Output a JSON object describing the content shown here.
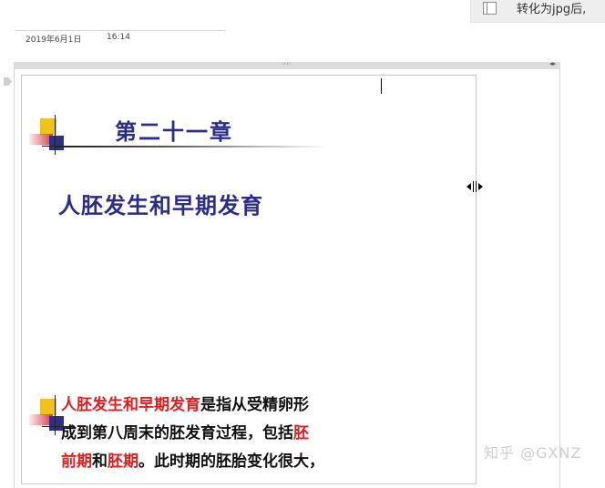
{
  "tooltip": {
    "icon": "document-icon",
    "text": "转化为jpg后,"
  },
  "note": {
    "date": "2019年6月1日",
    "time": "16:14"
  },
  "container": {
    "grip": "····",
    "arrows": "◂▸"
  },
  "cursor": {
    "resize_glyph": "◂|▸"
  },
  "slide": {
    "title": "第二十一章",
    "subtitle": "人胚发生和早期发育",
    "body": {
      "line1_red": "人胚发生和早期发育",
      "line1_black": "是指从受精卵形",
      "line2_black": "成到第八周末的胚发育过程，包括",
      "line2_red": "胚",
      "line3_red_a": "前期",
      "line3_black_a": "和",
      "line3_red_b": "胚期",
      "line3_black_b": "。此时期的胚胎变化很大，"
    },
    "colors": {
      "title": "#2c2c8a",
      "highlight": "#e02020",
      "yellow": "#f2c21c",
      "red": "#d83a48",
      "blue": "#2b2f8e"
    }
  },
  "watermark": "知乎 @GXNZ"
}
